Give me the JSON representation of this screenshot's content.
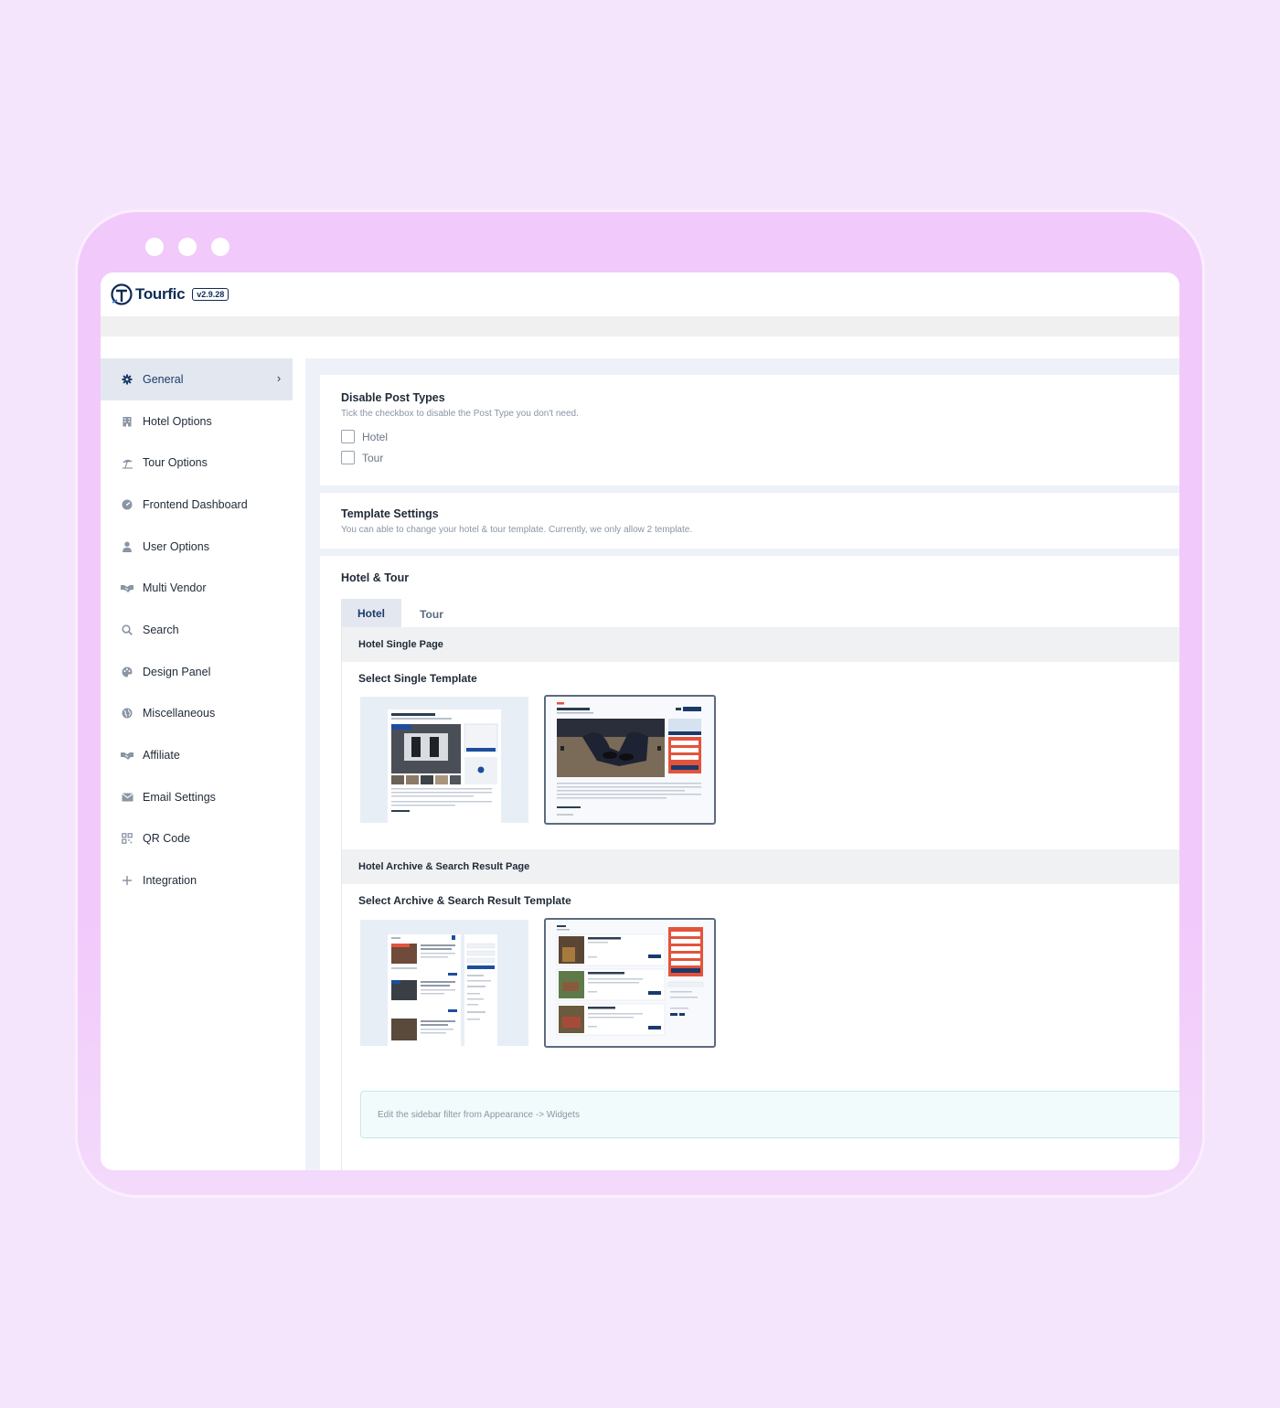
{
  "app": {
    "name": "Tourfic",
    "version": "v2.9.28"
  },
  "colors": {
    "accent": "#1b3a6b",
    "background": "#f4e5fd",
    "frame": "#f2c9fb",
    "selected_template_accent": "#e4533b"
  },
  "sidebar": {
    "items": [
      {
        "label": "General",
        "icon": "gear-icon",
        "active": true
      },
      {
        "label": "Hotel Options",
        "icon": "building-icon"
      },
      {
        "label": "Tour Options",
        "icon": "umbrella-beach-icon"
      },
      {
        "label": "Frontend Dashboard",
        "icon": "dashboard-icon"
      },
      {
        "label": "User Options",
        "icon": "user-icon"
      },
      {
        "label": "Multi Vendor",
        "icon": "handshake-icon"
      },
      {
        "label": "Search",
        "icon": "search-icon"
      },
      {
        "label": "Design Panel",
        "icon": "palette-icon"
      },
      {
        "label": "Miscellaneous",
        "icon": "globe-icon"
      },
      {
        "label": "Affiliate",
        "icon": "handshake-icon"
      },
      {
        "label": "Email Settings",
        "icon": "envelope-icon"
      },
      {
        "label": "QR Code",
        "icon": "qr-code-icon"
      },
      {
        "label": "Integration",
        "icon": "plus-icon"
      }
    ]
  },
  "disable_post_types": {
    "title": "Disable Post Types",
    "description": "Tick the checkbox to disable the Post Type you don't need.",
    "options": [
      {
        "label": "Hotel",
        "checked": false
      },
      {
        "label": "Tour",
        "checked": false
      }
    ]
  },
  "template_settings": {
    "title": "Template Settings",
    "description": "You can able to change your hotel & tour template. Currently, we only allow 2 template."
  },
  "hotel_tour": {
    "title": "Hotel & Tour",
    "tabs": [
      {
        "label": "Hotel",
        "active": true
      },
      {
        "label": "Tour",
        "active": false
      }
    ],
    "single_section": {
      "header": "Hotel Single Page",
      "label": "Select Single Template",
      "selected_index": 1
    },
    "archive_section": {
      "header": "Hotel Archive & Search Result Page",
      "label": "Select Archive & Search Result Template",
      "selected_index": 1
    },
    "notice": "Edit the sidebar filter from Appearance -> Widgets"
  }
}
